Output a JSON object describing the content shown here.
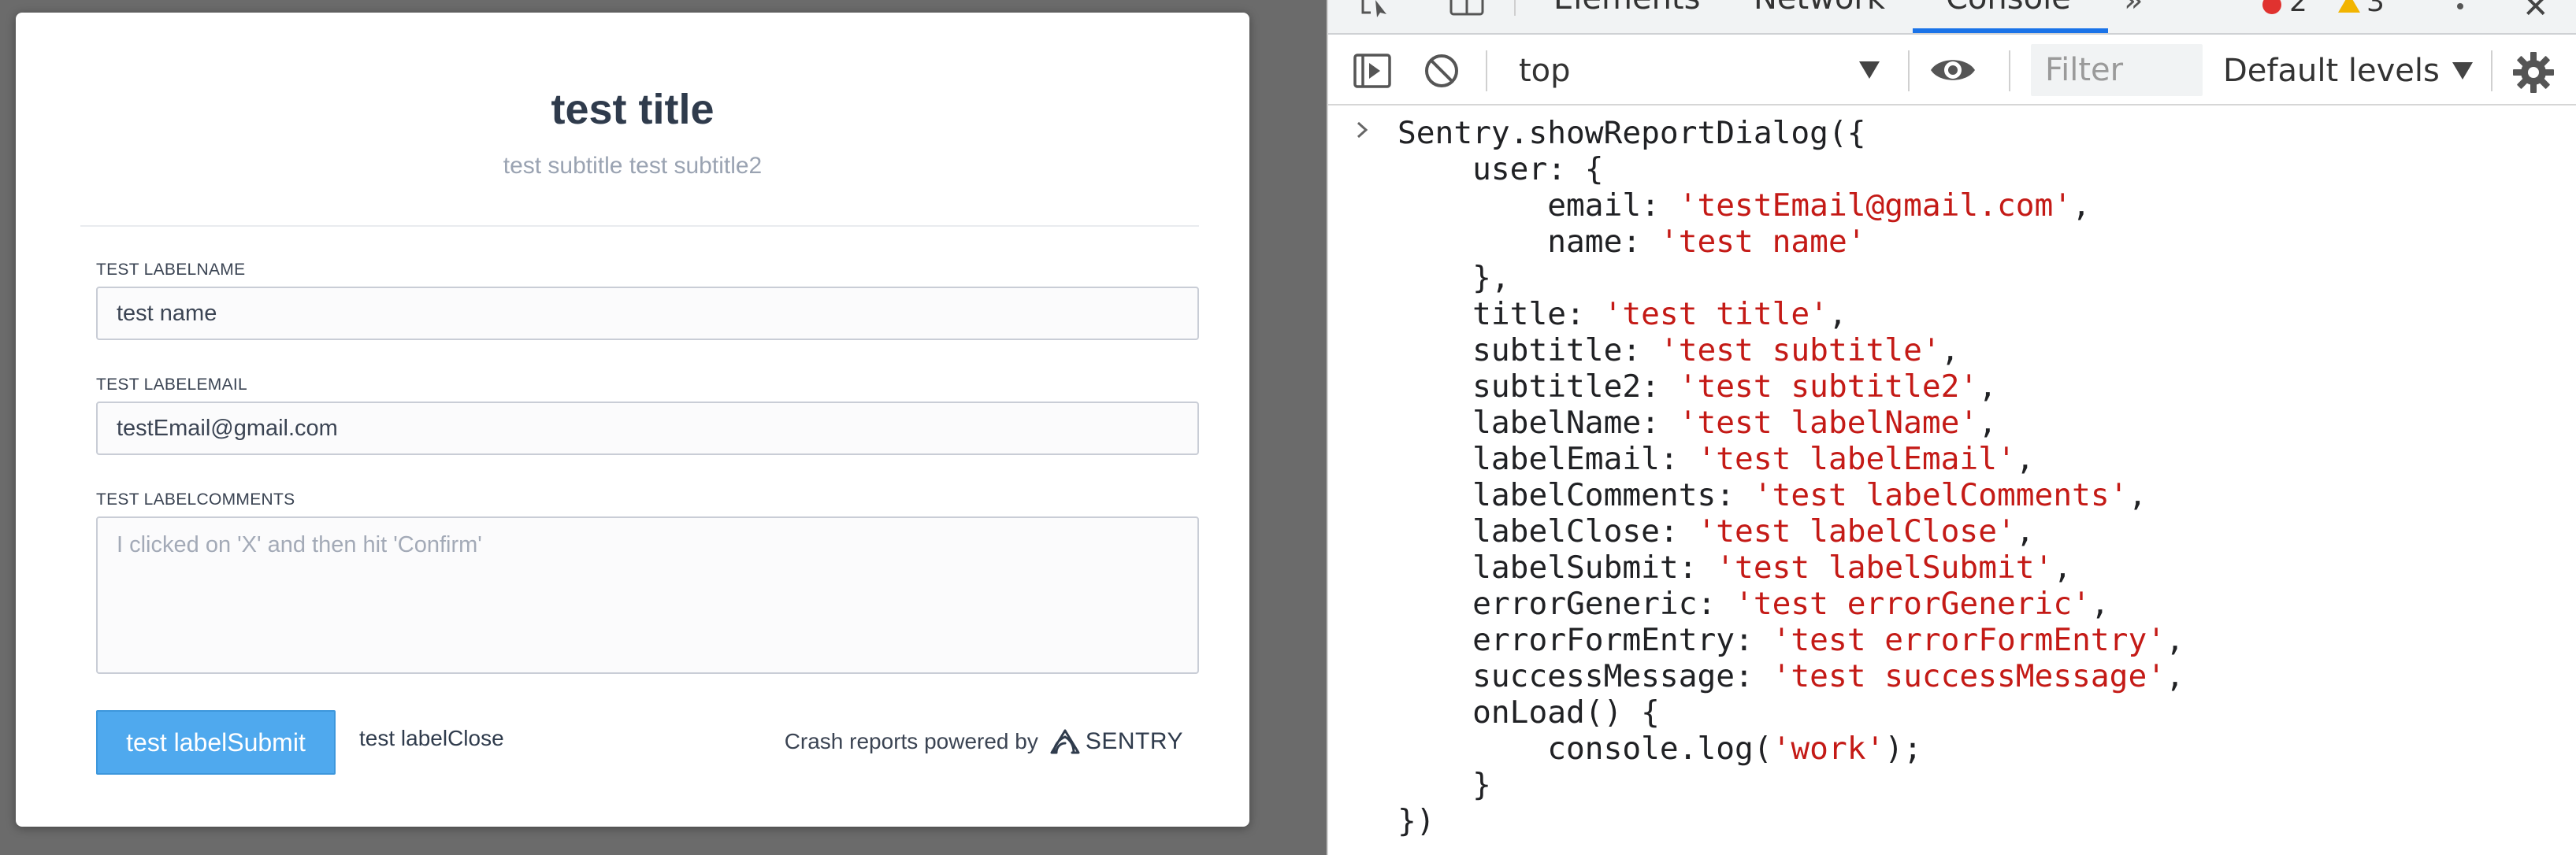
{
  "dialog": {
    "title": "test title",
    "subtitle": "test subtitle test subtitle2",
    "label_name": "TEST LABELNAME",
    "name_value": "test name",
    "label_email": "TEST LABELEMAIL",
    "email_value": "testEmail@gmail.com",
    "label_comments": "TEST LABELCOMMENTS",
    "comments_placeholder": "I clicked on 'X' and then hit 'Confirm'",
    "submit_label": "test labelSubmit",
    "close_label": "test labelClose",
    "powered_by": "Crash reports powered by",
    "sentry_wordmark": "SENTRY"
  },
  "devtools": {
    "tabs": [
      "Elements",
      "Network",
      "Console"
    ],
    "active_tab": "Console",
    "more_tabs": "»",
    "error_count": "2",
    "warning_count": "3",
    "context": "top",
    "filter_placeholder": "Filter",
    "levels": "Default levels",
    "icons": {
      "inspect": "inspect-element-icon",
      "device": "device-toolbar-icon",
      "sidebar": "console-sidebar-icon",
      "clear": "clear-console-icon",
      "eye": "live-expression-icon",
      "settings": "gear-icon",
      "menu": "kebab-menu-icon",
      "close": "close-icon"
    },
    "console_lines": [
      [
        {
          "t": "Sentry.showReportDialog({",
          "c": "k"
        }
      ],
      [
        {
          "t": "    user: {",
          "c": "k"
        }
      ],
      [
        {
          "t": "        email: ",
          "c": "k"
        },
        {
          "t": "'testEmail@gmail.com'",
          "c": "s"
        },
        {
          "t": ",",
          "c": "k"
        }
      ],
      [
        {
          "t": "        name: ",
          "c": "k"
        },
        {
          "t": "'test name'",
          "c": "s"
        }
      ],
      [
        {
          "t": "    },",
          "c": "k"
        }
      ],
      [
        {
          "t": "    title: ",
          "c": "k"
        },
        {
          "t": "'test title'",
          "c": "s"
        },
        {
          "t": ",",
          "c": "k"
        }
      ],
      [
        {
          "t": "    subtitle: ",
          "c": "k"
        },
        {
          "t": "'test subtitle'",
          "c": "s"
        },
        {
          "t": ",",
          "c": "k"
        }
      ],
      [
        {
          "t": "    subtitle2: ",
          "c": "k"
        },
        {
          "t": "'test subtitle2'",
          "c": "s"
        },
        {
          "t": ",",
          "c": "k"
        }
      ],
      [
        {
          "t": "    labelName: ",
          "c": "k"
        },
        {
          "t": "'test labelName'",
          "c": "s"
        },
        {
          "t": ",",
          "c": "k"
        }
      ],
      [
        {
          "t": "    labelEmail: ",
          "c": "k"
        },
        {
          "t": "'test labelEmail'",
          "c": "s"
        },
        {
          "t": ",",
          "c": "k"
        }
      ],
      [
        {
          "t": "    labelComments: ",
          "c": "k"
        },
        {
          "t": "'test labelComments'",
          "c": "s"
        },
        {
          "t": ",",
          "c": "k"
        }
      ],
      [
        {
          "t": "    labelClose: ",
          "c": "k"
        },
        {
          "t": "'test labelClose'",
          "c": "s"
        },
        {
          "t": ",",
          "c": "k"
        }
      ],
      [
        {
          "t": "    labelSubmit: ",
          "c": "k"
        },
        {
          "t": "'test labelSubmit'",
          "c": "s"
        },
        {
          "t": ",",
          "c": "k"
        }
      ],
      [
        {
          "t": "    errorGeneric: ",
          "c": "k"
        },
        {
          "t": "'test errorGeneric'",
          "c": "s"
        },
        {
          "t": ",",
          "c": "k"
        }
      ],
      [
        {
          "t": "    errorFormEntry: ",
          "c": "k"
        },
        {
          "t": "'test errorFormEntry'",
          "c": "s"
        },
        {
          "t": ",",
          "c": "k"
        }
      ],
      [
        {
          "t": "    successMessage: ",
          "c": "k"
        },
        {
          "t": "'test successMessage'",
          "c": "s"
        },
        {
          "t": ",",
          "c": "k"
        }
      ],
      [
        {
          "t": "    onLoad() {",
          "c": "k"
        }
      ],
      [
        {
          "t": "        console.log(",
          "c": "k"
        },
        {
          "t": "'work'",
          "c": "s"
        },
        {
          "t": ");",
          "c": "k"
        }
      ],
      [
        {
          "t": "    }",
          "c": "k"
        }
      ],
      [
        {
          "t": "})",
          "c": "k"
        }
      ]
    ]
  },
  "colors": {
    "submit_button": "#4fa9ee",
    "console_string": "#c41a16",
    "active_tab_underline": "#1a73e8",
    "error_badge": "#e0322f",
    "warning_badge": "#f2b400"
  }
}
